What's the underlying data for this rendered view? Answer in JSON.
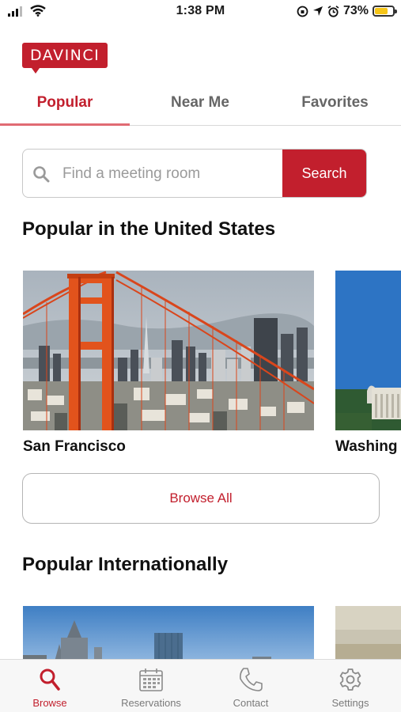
{
  "status_bar": {
    "time": "1:38 PM",
    "battery_percent": "73%",
    "battery_level": 0.73
  },
  "app": {
    "logo_text": "DAVINCI",
    "brand_color": "#c21f2d"
  },
  "tabs": [
    {
      "label": "Popular",
      "active": true
    },
    {
      "label": "Near Me",
      "active": false
    },
    {
      "label": "Favorites",
      "active": false
    }
  ],
  "search": {
    "placeholder": "Find a meeting room",
    "value": "",
    "button_label": "Search"
  },
  "popular_us": {
    "title": "Popular in the United States",
    "cards": [
      {
        "label": "San Francisco",
        "image": "golden-gate-bridge-photo"
      },
      {
        "label": "Washing",
        "image": "washington-monument-photo"
      }
    ],
    "browse_all_label": "Browse All"
  },
  "popular_intl": {
    "title": "Popular Internationally"
  },
  "bottom_nav": [
    {
      "label": "Browse",
      "icon": "search-icon",
      "active": true
    },
    {
      "label": "Reservations",
      "icon": "calendar-icon",
      "active": false
    },
    {
      "label": "Contact",
      "icon": "phone-icon",
      "active": false
    },
    {
      "label": "Settings",
      "icon": "gear-icon",
      "active": false
    }
  ]
}
